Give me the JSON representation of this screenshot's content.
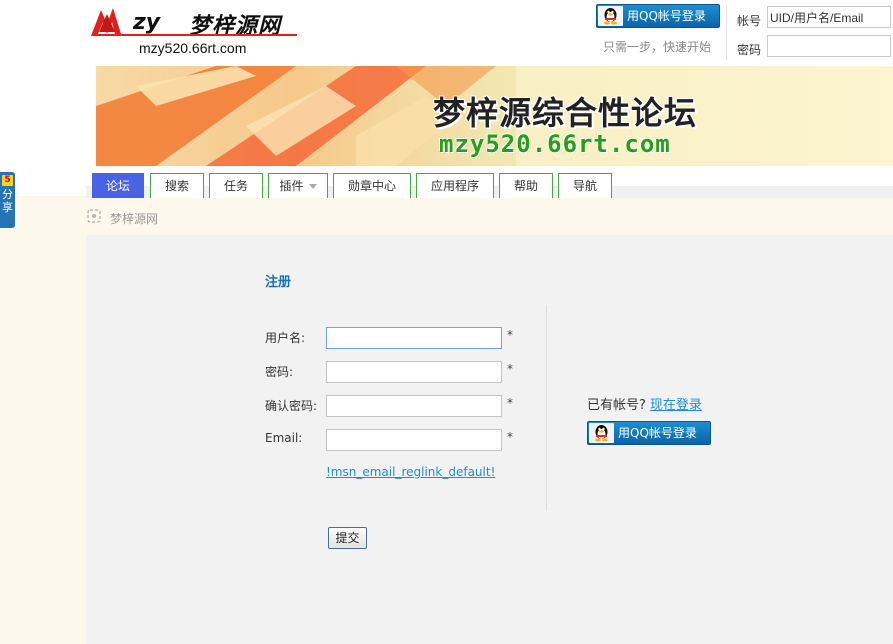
{
  "share": {
    "badge": "5",
    "label": "分享"
  },
  "logo": {
    "mark": "zy",
    "name": "梦梓源网",
    "url": "mzy520.66rt.com"
  },
  "header": {
    "qq_login_label": "用QQ帐号登录",
    "qq_tip": "只需一步，快速开始",
    "account_label": "帐号",
    "account_placeholder": "UID/用户名/Email",
    "password_label": "密码"
  },
  "banner": {
    "title": "梦梓源综合性论坛",
    "url": "mzy520.66rt.com"
  },
  "nav": {
    "items": [
      {
        "label": "论坛"
      },
      {
        "label": "搜索"
      },
      {
        "label": "任务"
      },
      {
        "label": "插件"
      },
      {
        "label": "勋章中心"
      },
      {
        "label": "应用程序"
      },
      {
        "label": "帮助"
      },
      {
        "label": "导航"
      }
    ],
    "active_index": 0
  },
  "breadcrumb": {
    "item": "梦梓源网"
  },
  "register": {
    "title": "注册",
    "fields": [
      {
        "label": "用户名:",
        "required": "*"
      },
      {
        "label": "密码:",
        "required": "*"
      },
      {
        "label": "确认密码:",
        "required": "*"
      },
      {
        "label": "Email:",
        "required": "*"
      }
    ],
    "msn_link": "!msn_email_reglink_default!",
    "submit_label": "提交"
  },
  "side": {
    "have_account": "已有帐号?",
    "login_now": "现在登录",
    "qq_login_label": "用QQ帐号登录"
  },
  "colors": {
    "nav_active": "#4a63e4",
    "nav_border": "#3fae3f",
    "link": "#1a8fd6",
    "qq_button": "#0b64a8"
  }
}
